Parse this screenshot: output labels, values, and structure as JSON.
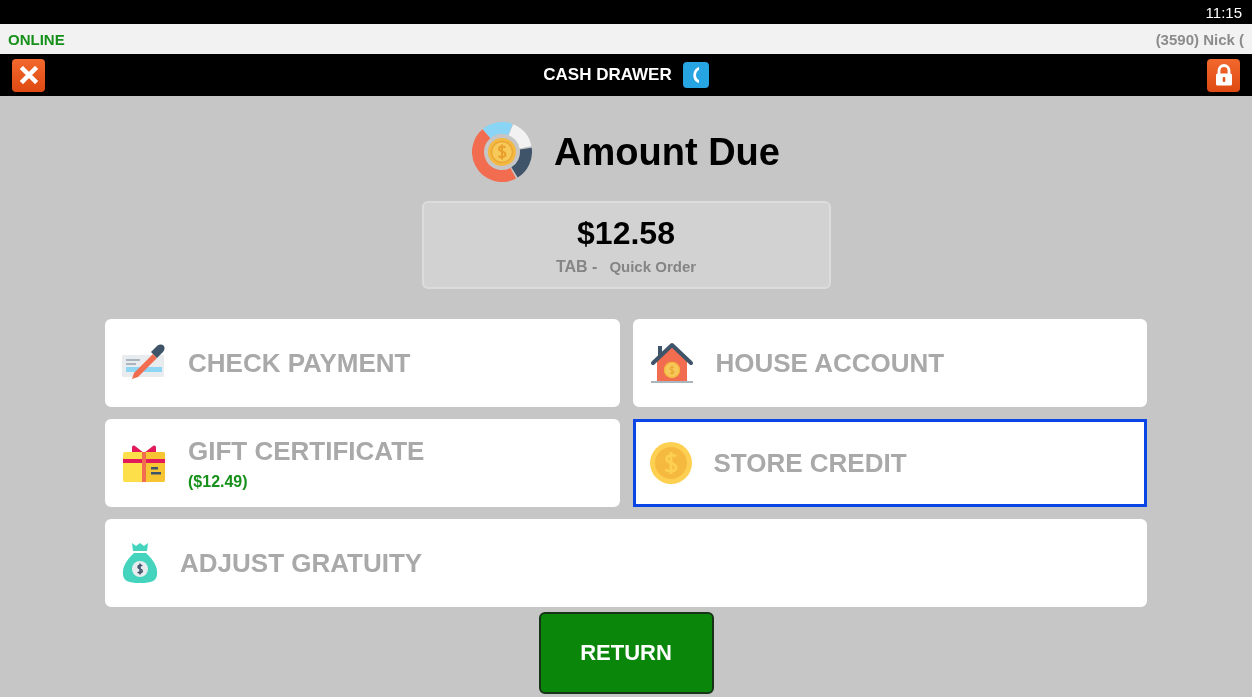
{
  "status_bar": {
    "time": "11:15"
  },
  "info_bar": {
    "connection": "ONLINE",
    "user": "(3590) Nick ("
  },
  "title_bar": {
    "title": "CASH DRAWER"
  },
  "amount_due": {
    "heading": "Amount Due",
    "amount": "$12.58",
    "tab_label": "TAB -",
    "tab_name": "Quick Order"
  },
  "payment_options": [
    {
      "kind": "check",
      "label": "CHECK PAYMENT",
      "selected": false,
      "full_width": false
    },
    {
      "kind": "house",
      "label": "HOUSE ACCOUNT",
      "selected": false,
      "full_width": false
    },
    {
      "kind": "gift",
      "label": "GIFT CERTIFICATE",
      "balance": "($12.49)",
      "selected": false,
      "full_width": false
    },
    {
      "kind": "coin",
      "label": "STORE CREDIT",
      "selected": true,
      "full_width": false
    },
    {
      "kind": "bag",
      "label": "ADJUST GRATUITY",
      "selected": false,
      "full_width": true
    }
  ],
  "return_button": "RETURN"
}
